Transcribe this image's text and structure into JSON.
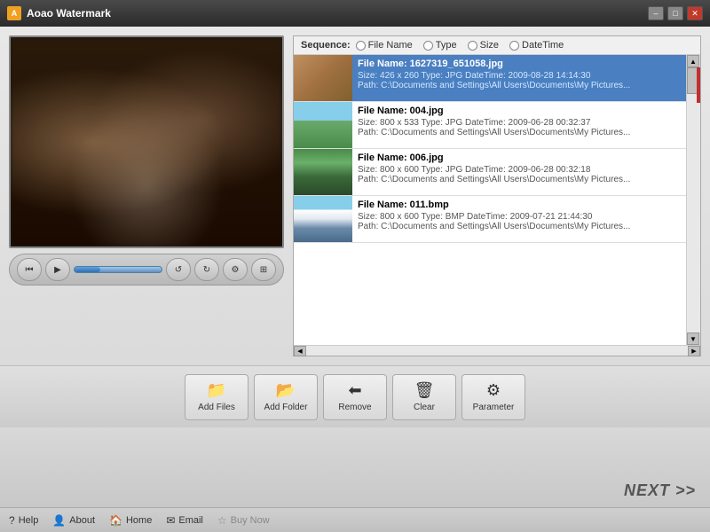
{
  "window": {
    "title": "Aoao Watermark",
    "controls": {
      "minimize": "–",
      "restore": "□",
      "close": "✕"
    }
  },
  "sequence": {
    "label": "Sequence:",
    "options": [
      {
        "id": "file-name",
        "label": "File Name",
        "checked": false
      },
      {
        "id": "type",
        "label": "Type",
        "checked": false
      },
      {
        "id": "size",
        "label": "Size",
        "checked": false
      },
      {
        "id": "datetime",
        "label": "DateTime",
        "checked": false
      }
    ]
  },
  "files": [
    {
      "name": "File Name: 1627319_651058.jpg",
      "size": "426 x 260",
      "type": "JPG",
      "datetime": "2009-08-28 14:14:30",
      "path": "Path: C:\\Documents and Settings\\All Users\\Documents\\My Pictures...",
      "selected": true,
      "thumb_class": "thumb-1"
    },
    {
      "name": "File Name: 004.jpg",
      "size": "800 x 533",
      "type": "JPG",
      "datetime": "2009-06-28 00:32:37",
      "path": "Path: C:\\Documents and Settings\\All Users\\Documents\\My Pictures...",
      "selected": false,
      "thumb_class": "thumb-2"
    },
    {
      "name": "File Name: 006.jpg",
      "size": "800 x 600",
      "type": "JPG",
      "datetime": "2009-06-28 00:32:18",
      "path": "Path: C:\\Documents and Settings\\All Users\\Documents\\My Pictures...",
      "selected": false,
      "thumb_class": "thumb-3"
    },
    {
      "name": "File Name: 011.bmp",
      "size": "800 x 600",
      "type": "BMP",
      "datetime": "2009-07-21 21:44:30",
      "path": "Path: C:\\Documents and Settings\\All Users\\Documents\\My Pictures...",
      "selected": false,
      "thumb_class": "thumb-4"
    }
  ],
  "controls": {
    "prev_label": "⏮",
    "play_label": "▶",
    "rewind_label": "↺",
    "forward_label": "↻",
    "settings_label": "⚙",
    "options_label": "⊞"
  },
  "toolbar": {
    "add_files_label": "Add Files",
    "add_folder_label": "Add Folder",
    "remove_label": "Remove",
    "clear_label": "Clear",
    "parameter_label": "Parameter"
  },
  "navigation": {
    "next_label": "NEXT >>"
  },
  "statusbar": {
    "help_label": "Help",
    "about_label": "About",
    "home_label": "Home",
    "email_label": "Email",
    "buynow_label": "Buy Now"
  }
}
